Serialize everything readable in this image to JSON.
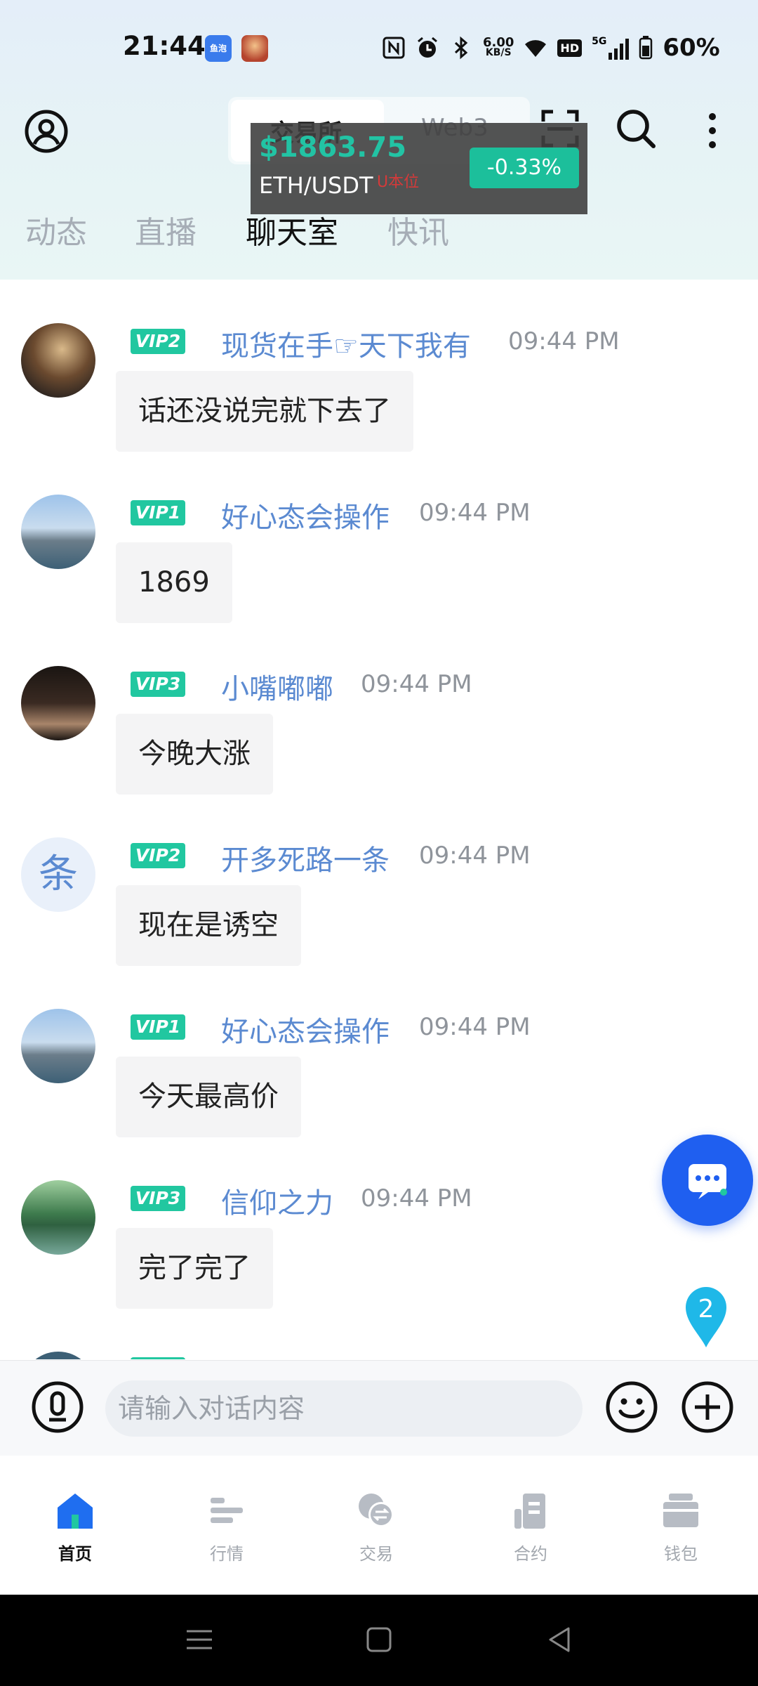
{
  "status_bar": {
    "time": "21:44",
    "net_speed_value": "6.00",
    "net_speed_unit": "KB/S",
    "hd_label": "HD",
    "signal_label": "5G",
    "battery": "60%"
  },
  "header": {
    "segments": {
      "exchange": "交易所",
      "web3": "Web3"
    },
    "price_ticker": {
      "price": "$1863.75",
      "pair": "ETH/USDT",
      "unit_tag": "U本位",
      "change": "-0.33%"
    },
    "tabs": [
      "动态",
      "直播",
      "聊天室",
      "快讯"
    ],
    "active_tab": "聊天室"
  },
  "messages": [
    {
      "vip": "VIP2",
      "user": "现货在手☞天下我有",
      "time": "09:44 PM",
      "text": "话还没说完就下去了"
    },
    {
      "vip": "VIP1",
      "user": "好心态会操作",
      "time": "09:44 PM",
      "text": "1869"
    },
    {
      "vip": "VIP3",
      "user": "小嘴嘟嘟",
      "time": "09:44 PM",
      "text": "今晚大涨"
    },
    {
      "vip": "VIP2",
      "user": "开多死路一条",
      "time": "09:44 PM",
      "text": "现在是诱空",
      "avatar_char": "条"
    },
    {
      "vip": "VIP1",
      "user": "好心态会操作",
      "time": "09:44 PM",
      "text": "今天最高价"
    },
    {
      "vip": "VIP3",
      "user": "信仰之力",
      "time": "09:44 PM",
      "text": "完了完了"
    }
  ],
  "unread_badge": "2",
  "input": {
    "placeholder": "请输入对话内容"
  },
  "bottom_nav": [
    {
      "label": "首页",
      "icon": "home-icon",
      "active": true
    },
    {
      "label": "行情",
      "icon": "market-icon"
    },
    {
      "label": "交易",
      "icon": "trade-icon"
    },
    {
      "label": "合约",
      "icon": "contract-icon"
    },
    {
      "label": "钱包",
      "icon": "wallet-icon"
    }
  ],
  "colors": {
    "accent_green": "#21c7a0",
    "username_blue": "#5b8ad1",
    "fab_blue": "#1f5ff0",
    "badge_cyan": "#1fb8e8"
  }
}
